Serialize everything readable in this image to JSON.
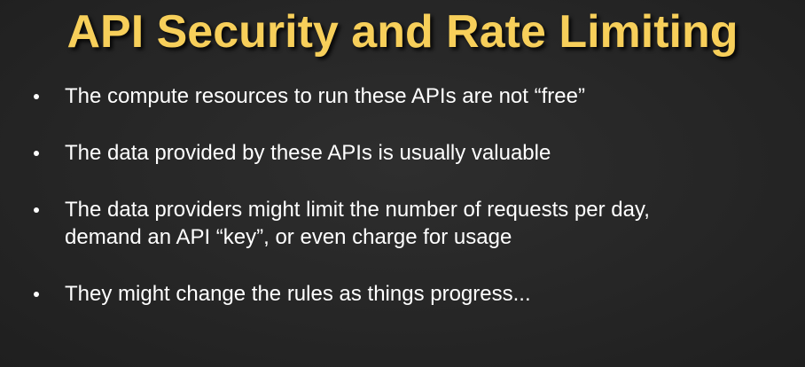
{
  "slide": {
    "title": "API Security and Rate Limiting",
    "bullets": [
      {
        "lines": [
          "The compute resources to run these APIs are not “free”"
        ]
      },
      {
        "lines": [
          "The data provided by these APIs is usually valuable"
        ]
      },
      {
        "lines": [
          "The data providers might limit the number of requests per day,",
          "demand an API “key”, or even charge for usage"
        ]
      },
      {
        "lines": [
          "They might change the rules as things progress..."
        ]
      }
    ]
  },
  "colors": {
    "title": "#f7cf5a",
    "background": "#262626",
    "text": "#ffffff"
  }
}
